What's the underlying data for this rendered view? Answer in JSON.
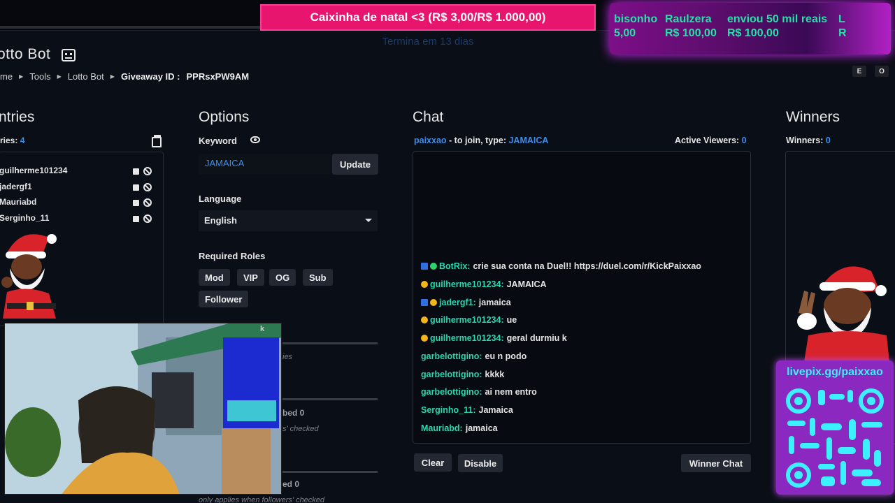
{
  "overlay": {
    "donation_title": "Caixinha de natal <3 (R$ 3,00/R$ 1.000,00)",
    "donation_sub": "Termina em 13 dias",
    "ticker": [
      {
        "name": "bisonho",
        "amount": "5,00"
      },
      {
        "name": "Raulzera",
        "amount": "R$ 100,00"
      },
      {
        "name": "enviou 50 mil reais",
        "amount": "R$ 100,00"
      },
      {
        "name": "L",
        "amount": "R"
      }
    ],
    "qr_url": "livepix.gg/paixxao"
  },
  "header": {
    "title": "otto Bot",
    "breadcrumb": [
      "me",
      "Tools",
      "Lotto Bot"
    ],
    "giveaway_label": "Giveaway ID :",
    "giveaway_id": "PPRsxPW9AM",
    "corner_buttons": [
      "E",
      "O"
    ]
  },
  "entries": {
    "title": "ntries",
    "count_label": "ries:",
    "count": "4",
    "items": [
      "guilherme101234",
      "jadergf1",
      "Mauriabd",
      "Serginho_11"
    ]
  },
  "options": {
    "title": "Options",
    "keyword_label": "Keyword",
    "keyword_value": "JAMAICA",
    "update_label": "Update",
    "language_label": "Language",
    "language_value": "English",
    "roles_label": "Required Roles",
    "roles": [
      "Mod",
      "VIP",
      "OG",
      "Sub",
      "Follower"
    ],
    "faint_1": "k",
    "faint_2": "ies",
    "faint_3": "bed 0",
    "faint_4": "s' checked",
    "faint_5": "ed 0",
    "faint_6": "only applies when followers' checked"
  },
  "chat": {
    "title": "Chat",
    "join_user": "paixxao",
    "join_text": "- to join, type:",
    "join_keyword": "JAMAICA",
    "viewers_label": "Active Viewers:",
    "viewers_count": "0",
    "messages": [
      {
        "user": "BotRix:",
        "text": "crie sua conta na Duel!! https://duel.com/r/KickPaixxao",
        "badges": "bot"
      },
      {
        "user": "guilherme101234:",
        "text": "JAMAICA",
        "badges": "coin"
      },
      {
        "user": "jadergf1:",
        "text": "jamaica",
        "badges": "blue-coin"
      },
      {
        "user": "guilherme101234:",
        "text": "ue",
        "badges": "coin"
      },
      {
        "user": "guilherme101234:",
        "text": "geral durmiu k",
        "badges": "coin"
      },
      {
        "user": "garbelottigino:",
        "text": "eu n podo",
        "badges": ""
      },
      {
        "user": "garbelottigino:",
        "text": "kkkk",
        "badges": ""
      },
      {
        "user": "garbelottigino:",
        "text": "ai nem entro",
        "badges": ""
      },
      {
        "user": "Serginho_11:",
        "text": "Jamaica",
        "badges": ""
      },
      {
        "user": "Mauriabd:",
        "text": "jamaica",
        "badges": ""
      }
    ],
    "clear_label": "Clear",
    "disable_label": "Disable",
    "winner_chat_label": "Winner Chat"
  },
  "winners": {
    "title": "Winners",
    "count_label": "Winners:",
    "count": "0"
  },
  "colors": {
    "accent": "#3e8ce8",
    "chat_user": "#2ad7b0",
    "donation_pink": "#e8156f",
    "ticker_green": "#27e0a7"
  }
}
